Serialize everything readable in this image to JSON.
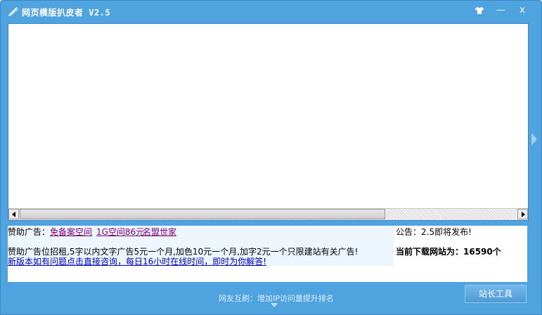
{
  "window": {
    "title": "网页模版扒皮者 V2.5",
    "controls": {
      "skin_icon": "shirt-icon",
      "minimize": "—",
      "close": "x"
    }
  },
  "ads": {
    "sponsor_label": "赞助广告：",
    "links": [
      "免备案空间",
      "1G空间86元",
      "名盟世家"
    ],
    "recruit_text": "赞助广告位招租,5字以内文字广告5元一个月,加色10元一个月,加字2元一个只限建站有关广告!",
    "consult_link": "新版本如有问题点击直接咨询，每日16小时在线时间，即时为你解答!",
    "notice": "公告：2.5即将发布!",
    "site_count_label": "当前下载网站为：16590个"
  },
  "footer": {
    "text": "网友互刷：增加IP访问量提升排名",
    "webmaster_button": "站长工具"
  },
  "colors": {
    "frame": "#4fa3de",
    "link_visited": "#800080",
    "link_blue": "#0000c0"
  }
}
